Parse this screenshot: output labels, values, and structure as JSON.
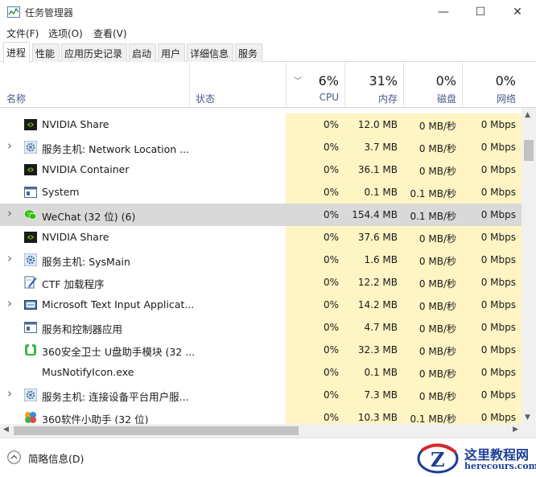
{
  "window": {
    "title": "任务管理器",
    "controls": [
      "—",
      "☐",
      "✕"
    ]
  },
  "menu": [
    "文件(F)",
    "选项(O)",
    "查看(V)"
  ],
  "tabs": [
    {
      "label": "进程",
      "active": true
    },
    {
      "label": "性能",
      "active": false
    },
    {
      "label": "应用历史记录",
      "active": false
    },
    {
      "label": "启动",
      "active": false
    },
    {
      "label": "用户",
      "active": false
    },
    {
      "label": "详细信息",
      "active": false
    },
    {
      "label": "服务",
      "active": false
    }
  ],
  "columns": {
    "name": "名称",
    "status": "状态",
    "cpu": {
      "percent": "6%",
      "label": "CPU"
    },
    "memory": {
      "percent": "31%",
      "label": "内存"
    },
    "disk": {
      "percent": "0%",
      "label": "磁盘"
    },
    "network": {
      "percent": "0%",
      "label": "网络"
    },
    "sorted_by": "CPU"
  },
  "processes": [
    {
      "name": "NVIDIA Share",
      "expandable": false,
      "icon": "nvidia-icon",
      "cpu": "0%",
      "memory": "12.0 MB",
      "disk": "0 MB/秒",
      "network": "0 Mbps"
    },
    {
      "name": "服务主机: Network Location ...",
      "expandable": true,
      "icon": "service-host-gear-icon",
      "cpu": "0%",
      "memory": "3.7 MB",
      "disk": "0 MB/秒",
      "network": "0 Mbps"
    },
    {
      "name": "NVIDIA Container",
      "expandable": false,
      "icon": "nvidia-icon",
      "cpu": "0%",
      "memory": "36.1 MB",
      "disk": "0 MB/秒",
      "network": "0 Mbps"
    },
    {
      "name": "System",
      "expandable": false,
      "icon": "system-window-icon",
      "cpu": "0%",
      "memory": "0.1 MB",
      "disk": "0.1 MB/秒",
      "network": "0 Mbps"
    },
    {
      "name": "WeChat (32 位) (6)",
      "expandable": true,
      "icon": "wechat-icon",
      "cpu": "0%",
      "memory": "154.4 MB",
      "disk": "0.1 MB/秒",
      "network": "0 Mbps",
      "selected": true
    },
    {
      "name": "NVIDIA Share",
      "expandable": false,
      "icon": "nvidia-icon",
      "cpu": "0%",
      "memory": "37.6 MB",
      "disk": "0 MB/秒",
      "network": "0 Mbps"
    },
    {
      "name": "服务主机: SysMain",
      "expandable": true,
      "icon": "service-host-gear-icon",
      "cpu": "0%",
      "memory": "1.6 MB",
      "disk": "0 MB/秒",
      "network": "0 Mbps"
    },
    {
      "name": "CTF 加载程序",
      "expandable": false,
      "icon": "ctf-pen-icon",
      "cpu": "0%",
      "memory": "12.2 MB",
      "disk": "0 MB/秒",
      "network": "0 Mbps"
    },
    {
      "name": "Microsoft Text Input Applicat...",
      "expandable": true,
      "icon": "text-input-icon",
      "cpu": "0%",
      "memory": "14.2 MB",
      "disk": "0 MB/秒",
      "network": "0 Mbps"
    },
    {
      "name": "服务和控制器应用",
      "expandable": false,
      "icon": "system-window-icon",
      "cpu": "0%",
      "memory": "4.7 MB",
      "disk": "0 MB/秒",
      "network": "0 Mbps"
    },
    {
      "name": "360安全卫士 U盘助手模块 (32 ...",
      "expandable": false,
      "icon": "360-shield-icon",
      "cpu": "0%",
      "memory": "32.3 MB",
      "disk": "0 MB/秒",
      "network": "0 Mbps"
    },
    {
      "name": "MusNotifyIcon.exe",
      "expandable": false,
      "icon": "blank-icon",
      "cpu": "0%",
      "memory": "0.1 MB",
      "disk": "0 MB/秒",
      "network": "0 Mbps"
    },
    {
      "name": "服务主机: 连接设备平台用户服...",
      "expandable": true,
      "icon": "service-host-gear-icon",
      "cpu": "0%",
      "memory": "7.3 MB",
      "disk": "0 MB/秒",
      "network": "0 Mbps"
    },
    {
      "name": "360软件小助手 (32 位)",
      "expandable": false,
      "icon": "360-assistant-icon",
      "cpu": "0%",
      "memory": "10.3 MB",
      "disk": "0.1 MB/秒",
      "network": "0 Mbps"
    }
  ],
  "footer": {
    "label": "简略信息(D)"
  },
  "watermark": {
    "zh": "这里教程网",
    "en": "herecours.com"
  },
  "colors": {
    "cpu_column_bg": "#fff4c4",
    "selected_row_bg": "#d9d9d9",
    "header_label": "#4a5a8a",
    "watermark": "#1c3f97"
  }
}
